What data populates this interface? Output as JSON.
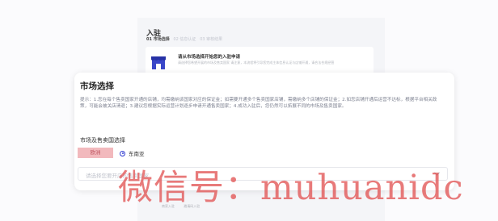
{
  "background": {
    "title": "入驻",
    "steps": [
      {
        "label": "01 市场选择",
        "active": true
      },
      {
        "label": "02 信息认证",
        "active": false
      },
      {
        "label": "03 审核结果",
        "active": false
      }
    ],
    "apply_title": "请从市场选择开始您的入驻申请",
    "apply_sub": "请选择您希望开展的市场及售卖国家 请注意，本流程将引导您完成主体信息认证与店铺开通，请合法合规经营",
    "footer_links": [
      "商家入驻",
      "邀请码入驻"
    ]
  },
  "modal": {
    "title": "市场选择",
    "hint": "提示：1.您在每个售卖国家开通的店铺，均需缴纳该国家对应的保证金；如需要开通多个售卖国家店铺，需缴纳多个店铺的保证金；2.如您店铺开通后运营不达标，根据平台相关政策，可能会被关店清退；3.建议您根据实际运营计划逐步申请开通售卖国家；4.成功入驻后，您仍然可以拓展不同的市场及售卖国家。",
    "section_label": "市场及售卖国选择",
    "regions": [
      {
        "label": "欧洲",
        "selected": false
      },
      {
        "label": "东南亚",
        "selected": true
      }
    ],
    "country_placeholder": "请选择您要开店的售卖国家"
  },
  "watermark": "微信号：muhuanidc",
  "colors": {
    "accent": "#2f3bd0",
    "region_highlight": "#f2b9bd",
    "watermark": "#e25454"
  }
}
